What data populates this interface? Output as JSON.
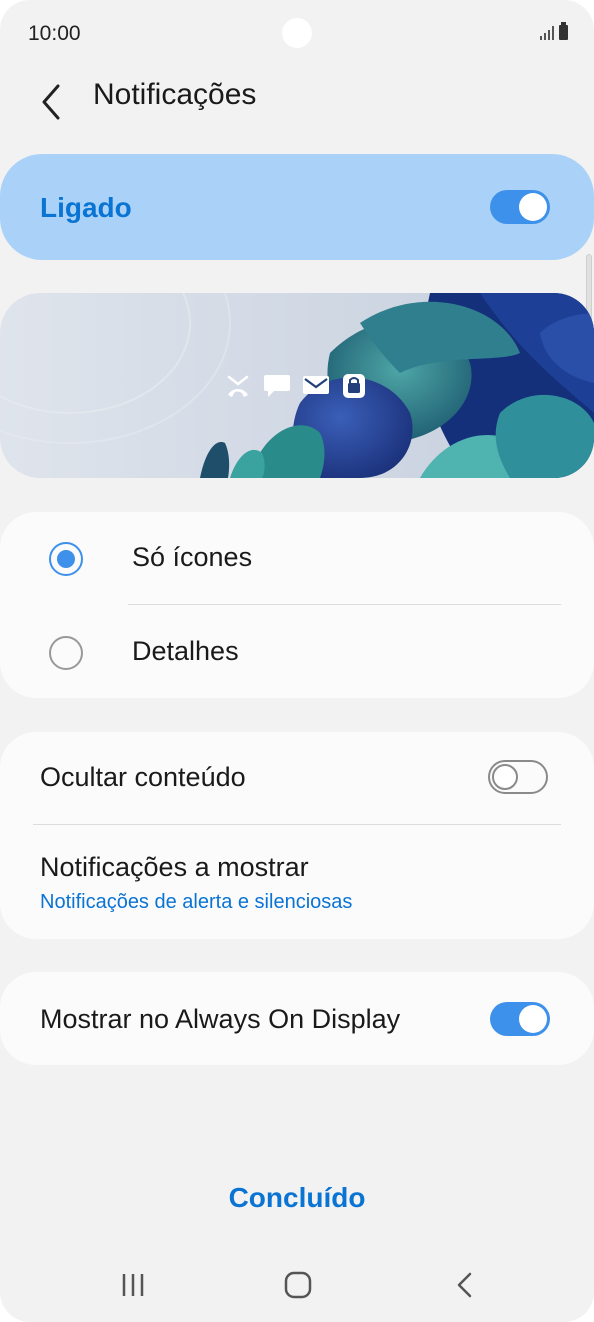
{
  "status_bar": {
    "time": "10:00",
    "icons": [
      "signal-icon",
      "battery-icon"
    ]
  },
  "header": {
    "title": "Notificações",
    "back_icon": "back-arrow-icon"
  },
  "master": {
    "label": "Ligado",
    "enabled": true
  },
  "preview": {
    "icons": [
      "missed-call-icon",
      "message-icon",
      "email-icon",
      "lock-icon"
    ]
  },
  "style_options": [
    {
      "label": "Só ícones",
      "selected": true
    },
    {
      "label": "Detalhes",
      "selected": false
    }
  ],
  "settings": {
    "hide_content": {
      "label": "Ocultar conteúdo",
      "enabled": false
    },
    "notifications_to_show": {
      "label": "Notificações a mostrar",
      "value": "Notificações de alerta e silenciosas"
    },
    "show_on_aod": {
      "label": "Mostrar no Always On Display",
      "enabled": true
    }
  },
  "done_label": "Concluído",
  "navbar": {
    "icons": [
      "recent-apps-icon",
      "home-icon",
      "back-icon"
    ]
  },
  "colors": {
    "accent": "#3e91ea",
    "link": "#0a74d4",
    "master_bg": "#aad2f8",
    "background": "#f2f2f2",
    "card": "#fbfbfb"
  }
}
